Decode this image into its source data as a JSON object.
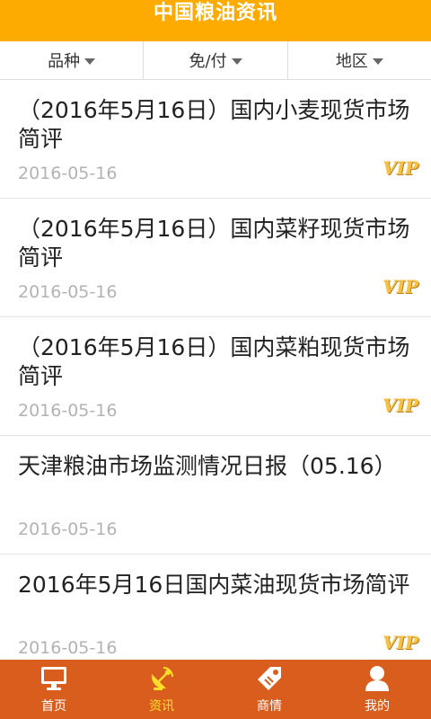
{
  "app": {
    "title": "中国粮油资讯"
  },
  "filters": [
    {
      "label": "品种"
    },
    {
      "label": "免/付"
    },
    {
      "label": "地区"
    }
  ],
  "news": [
    {
      "title": "（2016年5月16日）国内小麦现货市场简评",
      "date": "2016-05-16",
      "badge": "VIP"
    },
    {
      "title": "（2016年5月16日）国内菜籽现货市场简评",
      "date": "2016-05-16",
      "badge": "VIP"
    },
    {
      "title": "（2016年5月16日）国内菜粕现货市场简评",
      "date": "2016-05-16",
      "badge": "VIP"
    },
    {
      "title": "天津粮油市场监测情况日报（05.16）",
      "date": "2016-05-16",
      "badge": ""
    },
    {
      "title": "2016年5月16日国内菜油现货市场简评",
      "date": "2016-05-16",
      "badge": "VIP"
    }
  ],
  "bottom_nav": [
    {
      "label": "首页",
      "icon": "monitor-icon"
    },
    {
      "label": "资讯",
      "icon": "satellite-dish-icon",
      "active": true
    },
    {
      "label": "商情",
      "icon": "price-tag-icon"
    },
    {
      "label": "我的",
      "icon": "user-icon"
    }
  ],
  "colors": {
    "header": "#fdab00",
    "bottom_nav": "#d95e1e",
    "active_nav": "#ffdf2a",
    "vip": "#f6c04a"
  }
}
